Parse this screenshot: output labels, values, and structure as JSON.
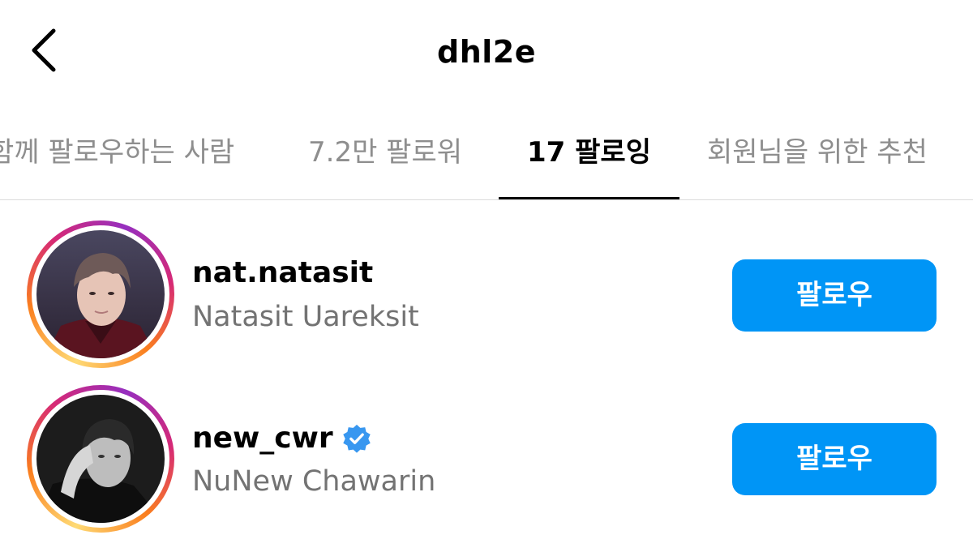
{
  "header": {
    "title": "dhl2e",
    "back_icon": "chevron-left-icon"
  },
  "tabs": [
    {
      "label": "함께 팔로우하는 사람",
      "active": false
    },
    {
      "label": "7.2만 팔로워",
      "active": false
    },
    {
      "label": "17 팔로잉",
      "active": true
    },
    {
      "label": "회원님을 위한 추천",
      "active": false
    }
  ],
  "accounts": [
    {
      "username": "nat.natasit",
      "full_name": "Natasit Uareksit",
      "verified": false,
      "button_label": "팔로우"
    },
    {
      "username": "new_cwr",
      "full_name": "NuNew Chawarin",
      "verified": true,
      "button_label": "팔로우"
    }
  ],
  "colors": {
    "accent": "#0095f6",
    "verified_badge": "#3897f0",
    "secondary_text": "#737373",
    "inactive_tab": "#8e8e8e",
    "divider": "#dbdbdb"
  }
}
